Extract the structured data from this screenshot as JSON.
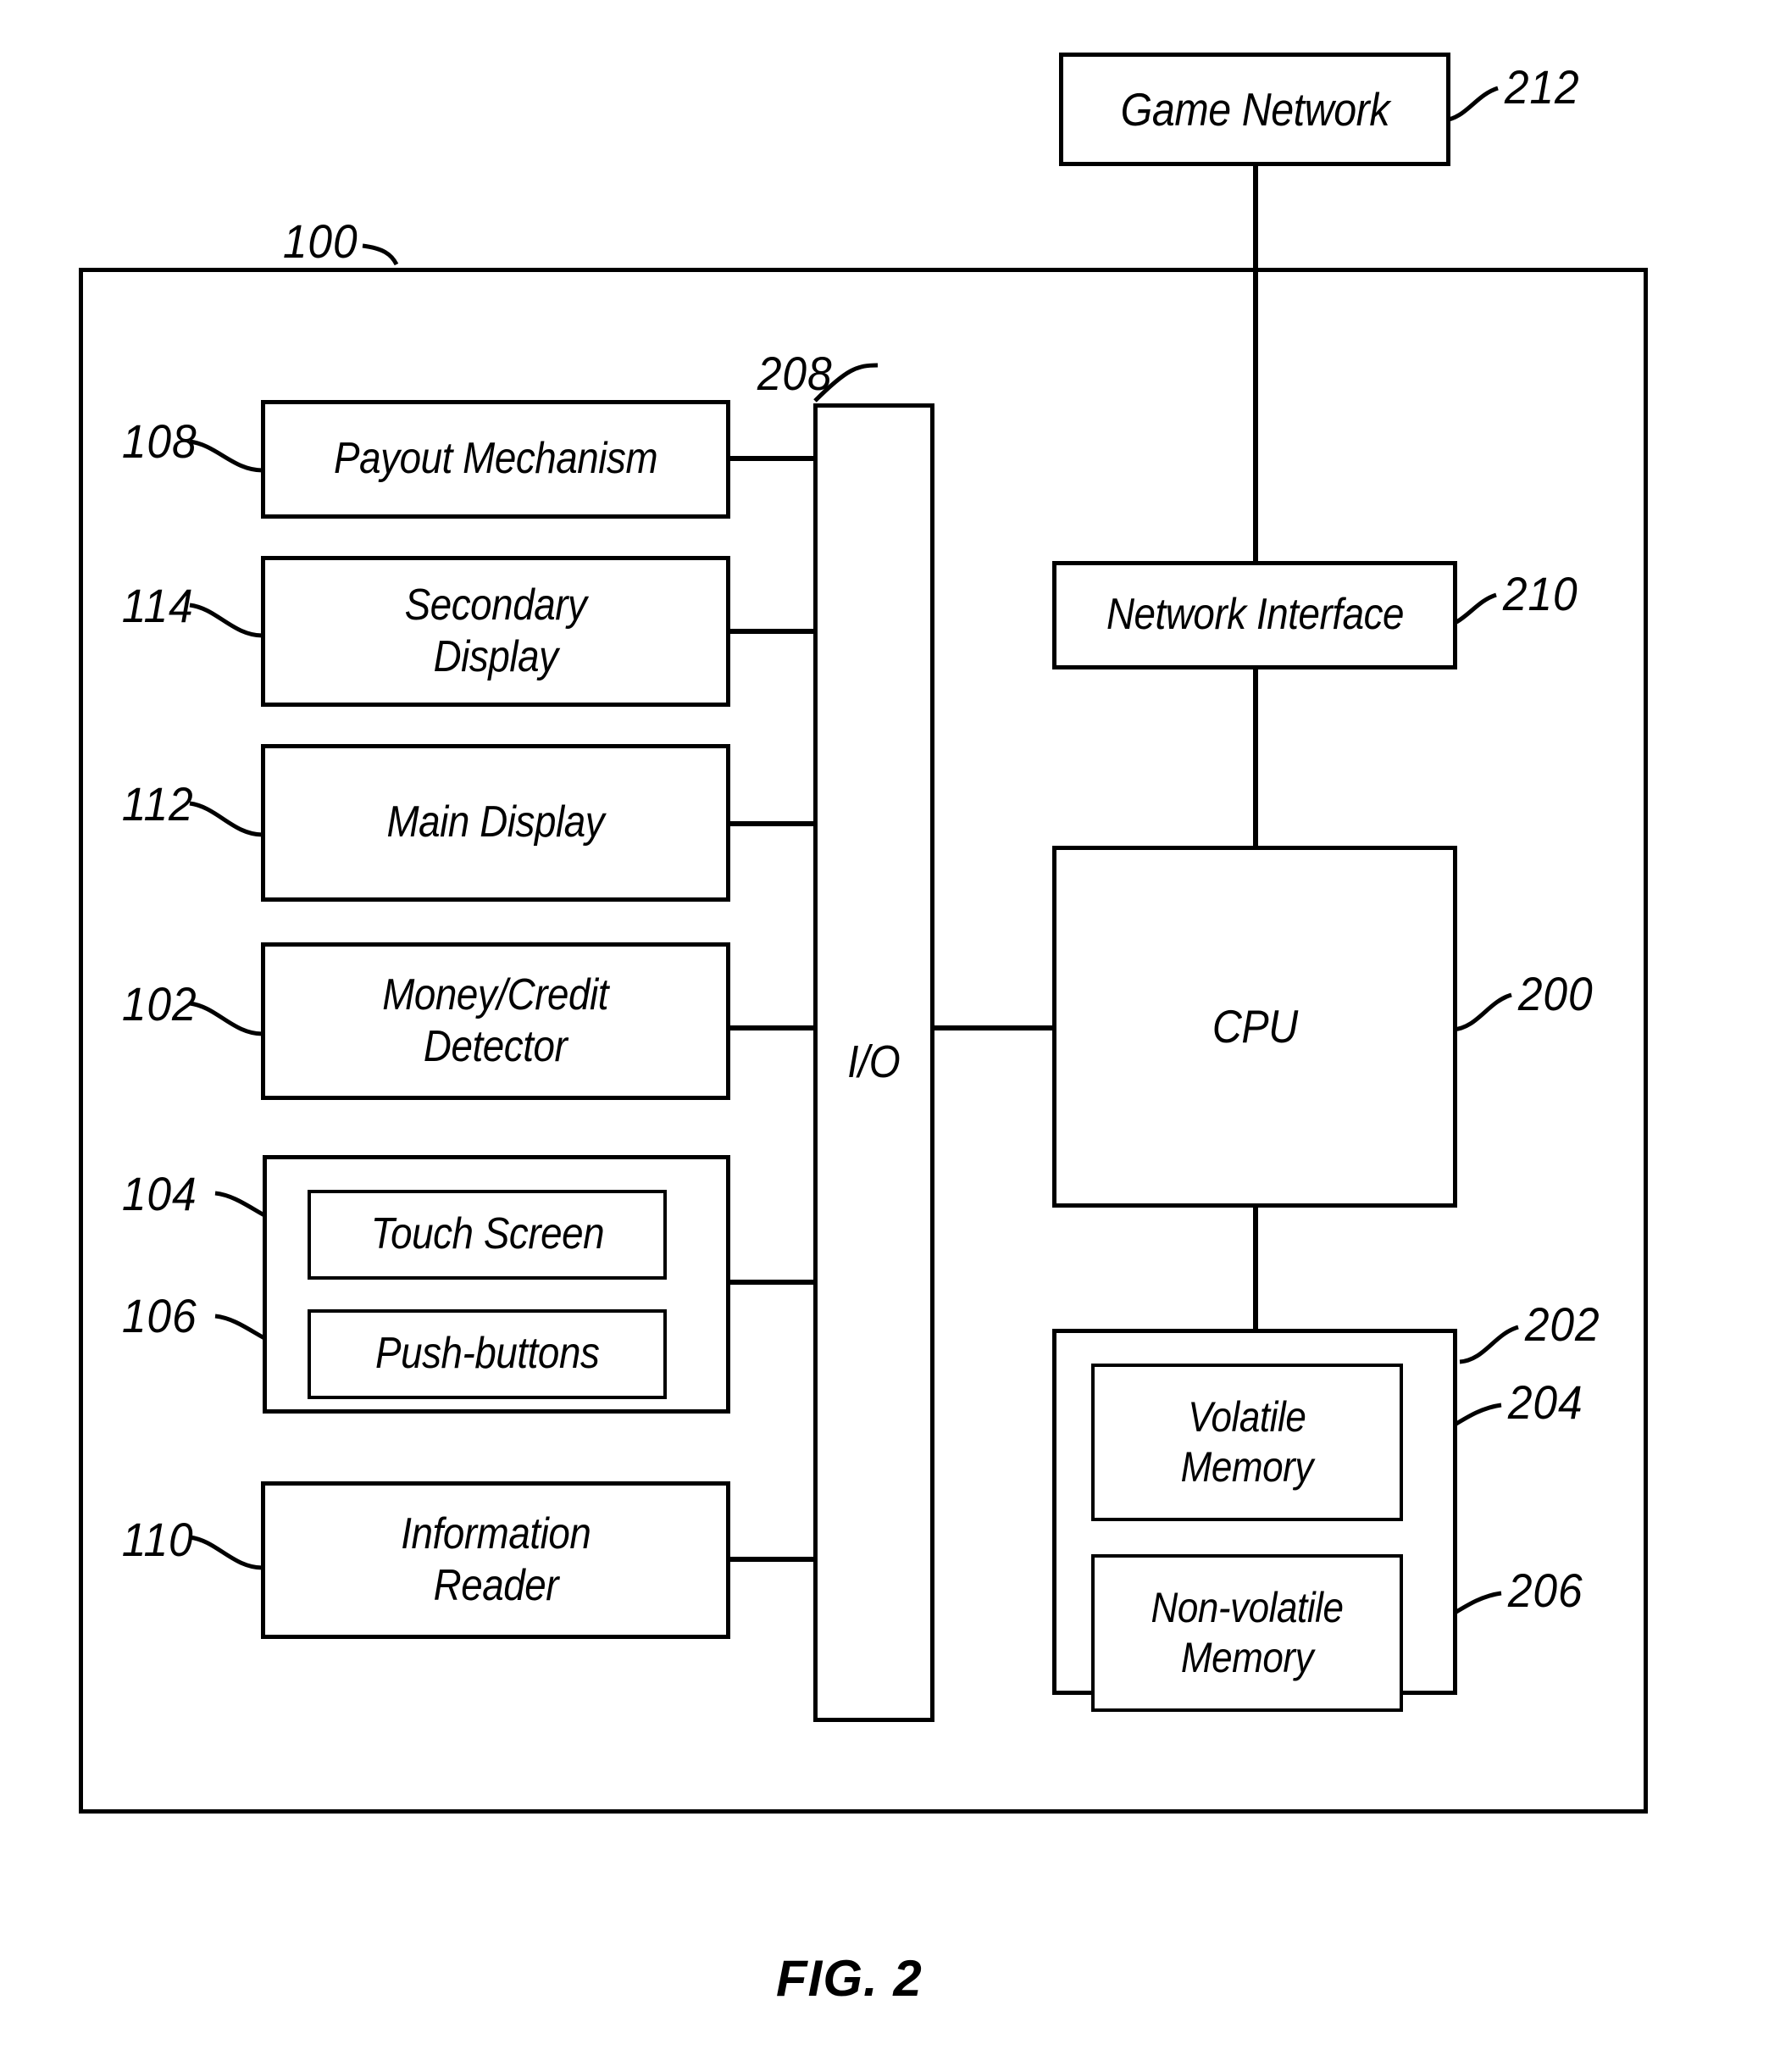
{
  "figure": {
    "caption": "FIG. 2",
    "system_ref": "100"
  },
  "nodes": {
    "game_network": {
      "label": "Game Network",
      "ref": "212"
    },
    "network_interface": {
      "label": "Network Interface",
      "ref": "210"
    },
    "cpu": {
      "label": "CPU",
      "ref": "200"
    },
    "memory_container": {
      "ref": "202"
    },
    "volatile_memory": {
      "label": "Volatile\nMemory",
      "ref": "204"
    },
    "nonvolatile_memory": {
      "label": "Non-volatile\nMemory",
      "ref": "206"
    },
    "io": {
      "label": "I/O",
      "ref": "208"
    },
    "payout_mechanism": {
      "label": "Payout Mechanism",
      "ref": "108"
    },
    "secondary_display": {
      "label": "Secondary\nDisplay",
      "ref": "114"
    },
    "main_display": {
      "label": "Main Display",
      "ref": "112"
    },
    "money_credit_detector": {
      "label": "Money/Credit\nDetector",
      "ref": "102"
    },
    "input_container": {
      "ref": ""
    },
    "touch_screen": {
      "label": "Touch Screen",
      "ref": "104"
    },
    "push_buttons": {
      "label": "Push-buttons",
      "ref": "106"
    },
    "information_reader": {
      "label": "Information\nReader",
      "ref": "110"
    }
  },
  "style": {
    "line_color": "#000000",
    "background": "#ffffff"
  }
}
